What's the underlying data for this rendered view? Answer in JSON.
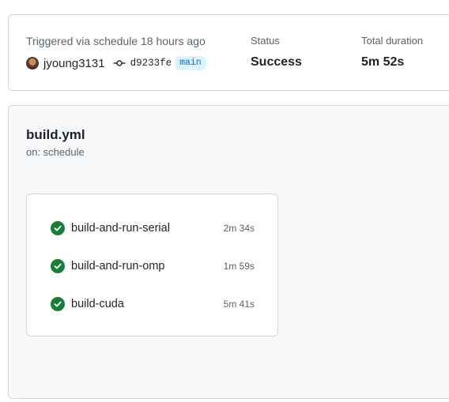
{
  "summary": {
    "trigger_text": "Triggered via schedule 18 hours ago",
    "actor": "jyoung3131",
    "commit_sha": "d9233fe",
    "branch": "main",
    "status_label": "Status",
    "status_value": "Success",
    "duration_label": "Total duration",
    "duration_value": "5m 52s"
  },
  "workflow": {
    "file": "build.yml",
    "trigger": "on: schedule",
    "jobs": [
      {
        "name": "build-and-run-serial",
        "duration": "2m 34s",
        "status": "success"
      },
      {
        "name": "build-and-run-omp",
        "duration": "1m 59s",
        "status": "success"
      },
      {
        "name": "build-cuda",
        "duration": "5m 41s",
        "status": "success"
      }
    ]
  },
  "colors": {
    "success": "#1a7f37",
    "branch_badge_bg": "#ddf4ff",
    "branch_badge_text": "#0969da"
  },
  "icons": {
    "commit": "git-commit-icon",
    "job_status": "check-circle-icon"
  }
}
